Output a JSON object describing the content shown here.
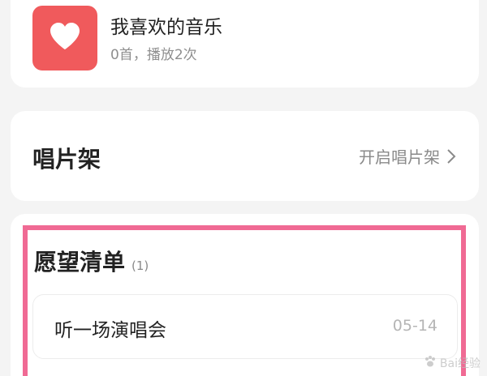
{
  "liked_music": {
    "title": "我喜欢的音乐",
    "subtitle": "0首，播放2次",
    "cover_color": "#f05a5c",
    "icon": "heart-icon"
  },
  "record_shelf": {
    "title": "唱片架",
    "action_label": "开启唱片架",
    "icon": "chevron-right-icon"
  },
  "wishlist": {
    "title": "愿望清单",
    "count": "(1)",
    "highlight_color": "#f06a94",
    "items": [
      {
        "title": "听一场演唱会",
        "date": "05-14"
      }
    ]
  },
  "watermark": {
    "text": "Bai经验",
    "icon": "baidu-paw-icon"
  }
}
